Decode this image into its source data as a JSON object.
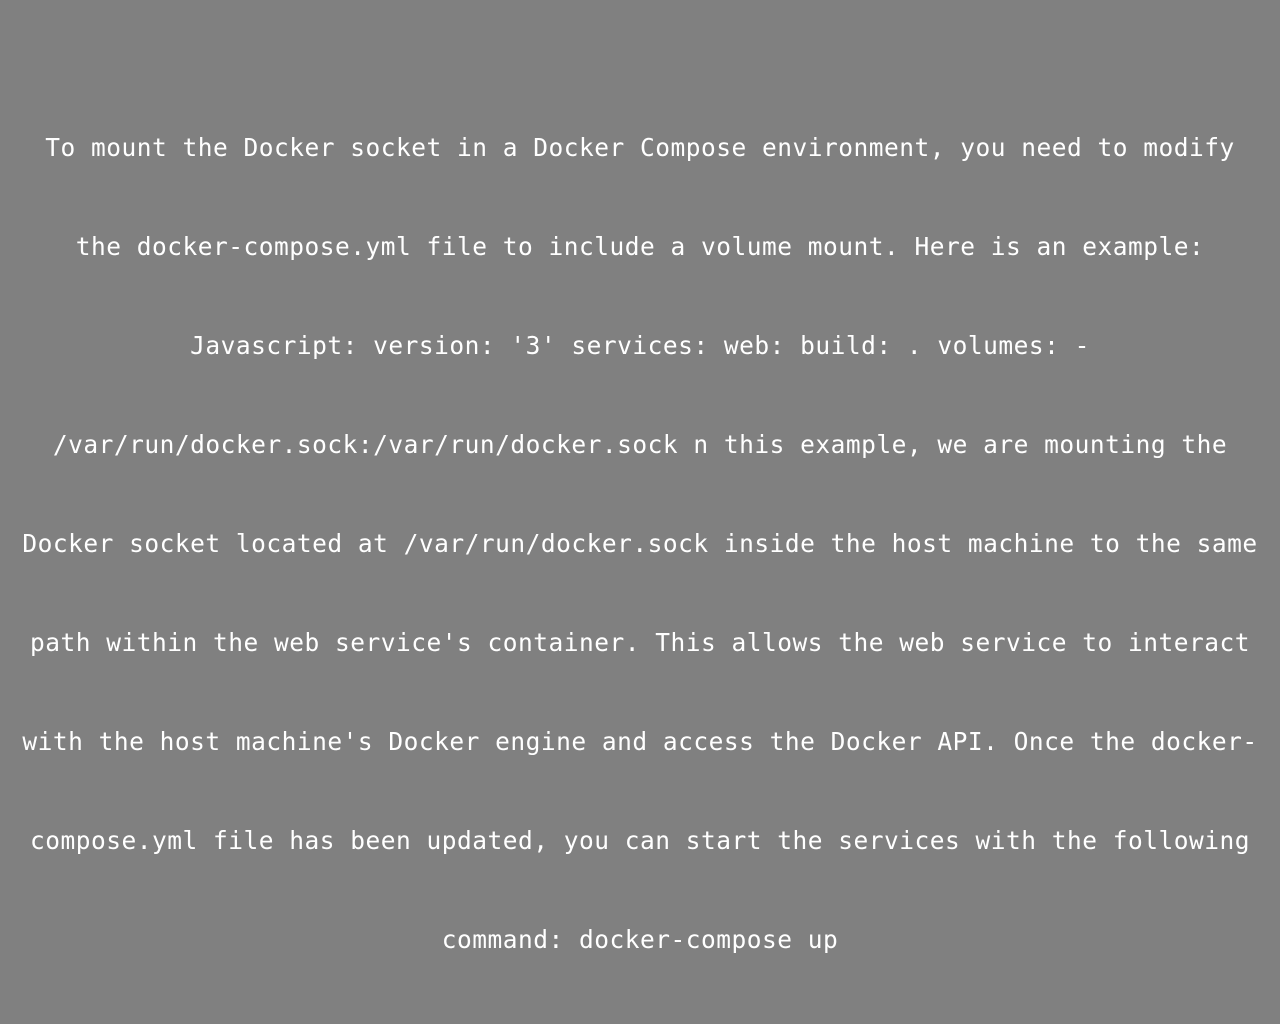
{
  "background_color": "#808080",
  "text_color": "#ffffff",
  "lines": [
    "To mount the Docker socket in a Docker Compose environment, you need to modify",
    "the docker-compose.yml file to include a volume mount. Here is an example:",
    "Javascript: version: '3' services: web: build: . volumes: -",
    "/var/run/docker.sock:/var/run/docker.sock n this example, we are mounting the",
    "Docker socket located at /var/run/docker.sock inside the host machine to the same",
    "path within the web service's container. This allows the web service to interact",
    "with the host machine's Docker engine and access the Docker API. Once the docker-",
    "compose.yml file has been updated, you can start the services with the following",
    "command: docker-compose up"
  ]
}
